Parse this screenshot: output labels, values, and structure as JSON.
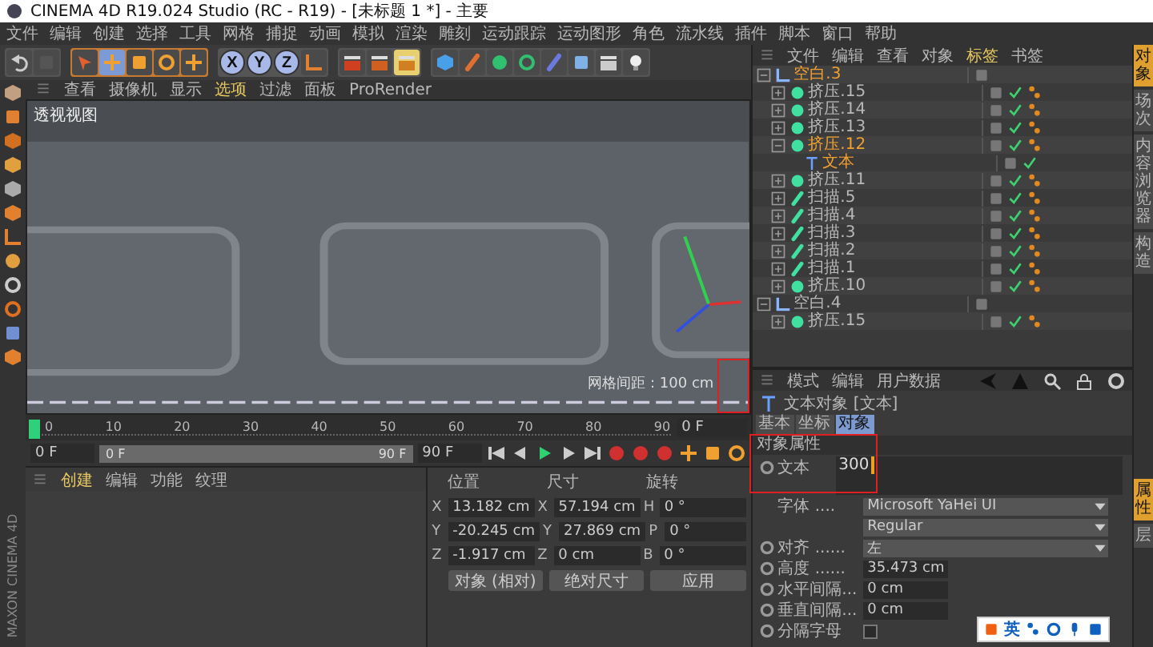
{
  "window": {
    "title": "CINEMA 4D R19.024 Studio (RC - R19) - [未标题 1 *] - 主要"
  },
  "menu": [
    "文件",
    "编辑",
    "创建",
    "选择",
    "工具",
    "网格",
    "捕捉",
    "动画",
    "模拟",
    "渲染",
    "雕刻",
    "运动跟踪",
    "运动图形",
    "角色",
    "流水线",
    "插件",
    "脚本",
    "窗口",
    "帮助"
  ],
  "toolbar": {
    "axis_buttons": [
      {
        "label": "X",
        "on": true
      },
      {
        "label": "Y",
        "on": true
      },
      {
        "label": "Z",
        "on": true
      }
    ]
  },
  "viewport": {
    "menu": [
      {
        "label": "查看",
        "selected": false
      },
      {
        "label": "摄像机",
        "selected": false
      },
      {
        "label": "显示",
        "selected": false
      },
      {
        "label": "选项",
        "selected": true
      },
      {
        "label": "过滤",
        "selected": false
      },
      {
        "label": "面板",
        "selected": false
      },
      {
        "label": "ProRender",
        "selected": false
      }
    ],
    "view_label": "透视视图",
    "grid_label": "网格间距 : 100 cm"
  },
  "timeline": {
    "ticks": [
      "0",
      "10",
      "20",
      "30",
      "40",
      "50",
      "60",
      "70",
      "80",
      "90"
    ],
    "current_frame": "0 F"
  },
  "transport": {
    "start": "0 F",
    "range_start": "0 F",
    "range_end": "90 F",
    "end": "90 F",
    "level": 1
  },
  "material_manager": {
    "menu": [
      {
        "label": "创建",
        "selected": true
      },
      {
        "label": "编辑",
        "selected": false
      },
      {
        "label": "功能",
        "selected": false
      },
      {
        "label": "纹理",
        "selected": false
      }
    ]
  },
  "coordinates": {
    "headers": [
      "位置",
      "尺寸",
      "旋转"
    ],
    "rows": [
      {
        "axes": [
          "X",
          "X",
          "H"
        ],
        "values": [
          "13.182 cm",
          "57.194 cm",
          "0 °"
        ]
      },
      {
        "axes": [
          "Y",
          "Y",
          "P"
        ],
        "values": [
          "-20.245 cm",
          "27.869 cm",
          "0 °"
        ]
      },
      {
        "axes": [
          "Z",
          "Z",
          "B"
        ],
        "values": [
          "-1.917 cm",
          "0 cm",
          "0 °"
        ]
      }
    ],
    "dropdowns": [
      "对象 (相对)",
      "绝对尺寸"
    ],
    "apply": "应用"
  },
  "brand": "MAXON CINEMA 4D",
  "object_manager": {
    "menu": [
      {
        "label": "文件",
        "selected": false
      },
      {
        "label": "编辑",
        "selected": false
      },
      {
        "label": "查看",
        "selected": false
      },
      {
        "label": "对象",
        "selected": false
      },
      {
        "label": "标签",
        "selected": true
      },
      {
        "label": "书签",
        "selected": false
      }
    ],
    "objects": [
      {
        "name": "空白.3",
        "kind": "null",
        "selected": true,
        "expanded": true,
        "children": [
          {
            "name": "挤压.15",
            "kind": "extrude",
            "selected": false,
            "expanded": false
          },
          {
            "name": "挤压.14",
            "kind": "extrude",
            "selected": false,
            "expanded": false
          },
          {
            "name": "挤压.13",
            "kind": "extrude",
            "selected": false,
            "expanded": false
          },
          {
            "name": "挤压.12",
            "kind": "extrude",
            "selected": true,
            "expanded": true,
            "children": [
              {
                "name": "文本",
                "kind": "text",
                "selected": true
              }
            ]
          },
          {
            "name": "挤压.11",
            "kind": "extrude",
            "selected": false,
            "expanded": false
          },
          {
            "name": "扫描.5",
            "kind": "sweep",
            "selected": false,
            "expanded": false
          },
          {
            "name": "扫描.4",
            "kind": "sweep",
            "selected": false,
            "expanded": false
          },
          {
            "name": "扫描.3",
            "kind": "sweep",
            "selected": false,
            "expanded": false
          },
          {
            "name": "扫描.2",
            "kind": "sweep",
            "selected": false,
            "expanded": false
          },
          {
            "name": "扫描.1",
            "kind": "sweep",
            "selected": false,
            "expanded": false
          },
          {
            "name": "挤压.10",
            "kind": "extrude",
            "selected": false,
            "expanded": false
          }
        ]
      },
      {
        "name": "空白.4",
        "kind": "null",
        "selected": false,
        "expanded": true,
        "children": [
          {
            "name": "挤压.15",
            "kind": "extrude",
            "selected": false,
            "expanded": false
          }
        ]
      }
    ]
  },
  "attributes": {
    "menu": [
      "模式",
      "编辑",
      "用户数据"
    ],
    "title": "文本对象 [文本]",
    "tabs": [
      {
        "label": "基本",
        "selected": false
      },
      {
        "label": "坐标",
        "selected": false
      },
      {
        "label": "对象",
        "selected": true
      }
    ],
    "section": "对象属性",
    "text_label": "文本",
    "text_value": "300",
    "fields": [
      {
        "label": "字体 ....",
        "kind": "dropdown",
        "value": "Microsoft YaHei UI",
        "animatable": false
      },
      {
        "kind": "dropdown",
        "value": "Regular",
        "animatable": false
      },
      {
        "label": "对齐 ......",
        "kind": "dropdown",
        "value": "左",
        "animatable": true
      },
      {
        "label": "高度 ......",
        "kind": "number",
        "value": "35.473 cm",
        "animatable": true
      },
      {
        "label": "水平间隔...",
        "kind": "number",
        "value": "0 cm",
        "animatable": true
      },
      {
        "label": "垂直间隔...",
        "kind": "number",
        "value": "0 cm",
        "animatable": true
      },
      {
        "label": "分隔字母",
        "kind": "checkbox",
        "checked": false,
        "animatable": true
      }
    ]
  },
  "right_tabs": [
    {
      "label": "对象",
      "selected": true
    },
    {
      "label": "场次",
      "selected": false
    },
    {
      "label": "内容浏览器",
      "selected": false
    },
    {
      "label": "构造",
      "selected": false
    }
  ],
  "right_tabs_bottom": [
    {
      "label": "属性",
      "selected": true
    },
    {
      "label": "层",
      "selected": false
    }
  ],
  "ime_bar": {
    "label": "英"
  }
}
